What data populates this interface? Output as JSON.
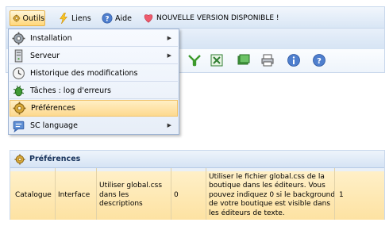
{
  "menubar": {
    "outils_label": "Outils",
    "liens_label": "Liens",
    "aide_label": "Aide",
    "news_label": "NOUVELLE VERSION DISPONIBLE !"
  },
  "dropdown": {
    "items": [
      {
        "label": "Installation",
        "icon": "gear-icon",
        "submenu": true
      },
      {
        "label": "Serveur",
        "icon": "server-icon",
        "submenu": true
      },
      {
        "label": "Historique des modifications",
        "icon": "history-icon",
        "submenu": false
      },
      {
        "label": "Tâches : log d'erreurs",
        "icon": "bug-icon",
        "submenu": false
      },
      {
        "label": "Préférences",
        "icon": "preferences-gear-icon",
        "submenu": false,
        "active": true
      },
      {
        "label": "SC language",
        "icon": "language-icon",
        "submenu": true
      }
    ]
  },
  "panel": {
    "title": "Préférences",
    "row": {
      "col1": "Catalogue",
      "col2": "Interface",
      "col3": "Utiliser global.css dans les descriptions",
      "col4": "0",
      "col5": "Utiliser le fichier global.css de la boutique dans les éditeurs. Vous pouvez indiquez 0 si le background de votre boutique est visible dans les éditeurs de texte.",
      "col6": "1"
    }
  },
  "colors": {
    "menubar_bg": "#d9e6f5",
    "active_item_bg": "#fdd98f",
    "panel_title": "#15315a"
  }
}
